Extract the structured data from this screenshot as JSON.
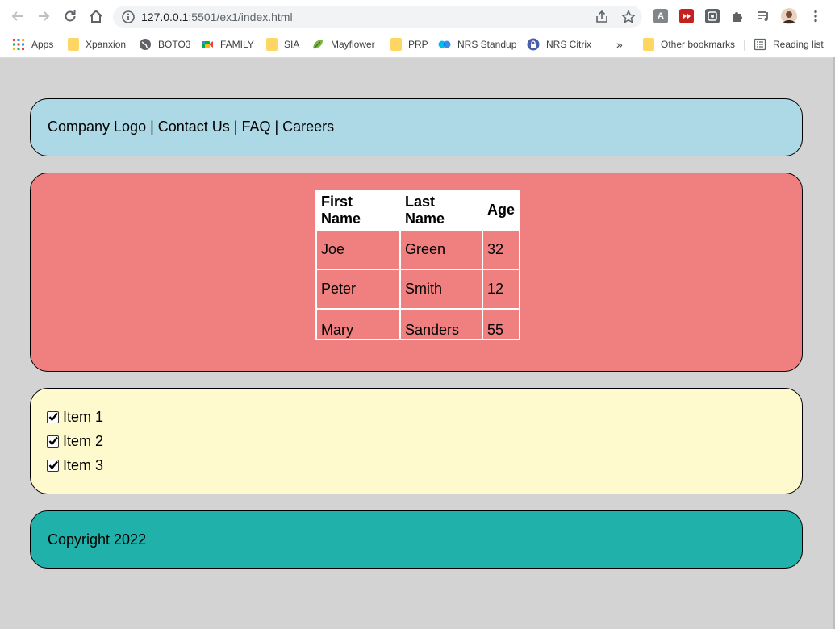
{
  "browser": {
    "url_host": "127.0.0.1",
    "url_path": ":5501/ex1/index.html",
    "bookmarks": [
      {
        "label": "Apps",
        "icon": "apps-grid-icon"
      },
      {
        "label": "Xpanxion",
        "icon": "folder-icon"
      },
      {
        "label": "BOTO3",
        "icon": "globe-icon"
      },
      {
        "label": "FAMILY",
        "icon": "meet-icon"
      },
      {
        "label": "SIA",
        "icon": "folder-icon"
      },
      {
        "label": "Mayflower",
        "icon": "leaf-icon"
      },
      {
        "label": "PRP",
        "icon": "folder-icon"
      },
      {
        "label": "NRS Standup",
        "icon": "webex-icon"
      },
      {
        "label": "NRS Citrix",
        "icon": "lock-icon"
      }
    ],
    "more_bookmarks": "»",
    "other_bookmarks": "Other bookmarks",
    "reading_list": "Reading list",
    "ext_a": "A"
  },
  "header": {
    "nav_text": "Company Logo | Contact Us | FAQ | Careers"
  },
  "people_table": {
    "headers": [
      "First Name",
      "Last Name",
      "Age"
    ],
    "rows": [
      [
        "Joe",
        "Green",
        "32"
      ],
      [
        "Peter",
        "Smith",
        "12"
      ],
      [
        "Mary",
        "Sanders",
        "55"
      ]
    ]
  },
  "checklist": {
    "items": [
      {
        "label": "Item 1",
        "checked": true
      },
      {
        "label": "Item 2",
        "checked": true
      },
      {
        "label": "Item 3",
        "checked": true
      }
    ]
  },
  "footer": {
    "copyright": "Copyright 2022"
  },
  "colors": {
    "header_bg": "#add8e6",
    "table_bg": "#f08080",
    "list_bg": "#fffacd",
    "footer_bg": "#20b2aa",
    "page_bg": "#d3d3d3"
  }
}
